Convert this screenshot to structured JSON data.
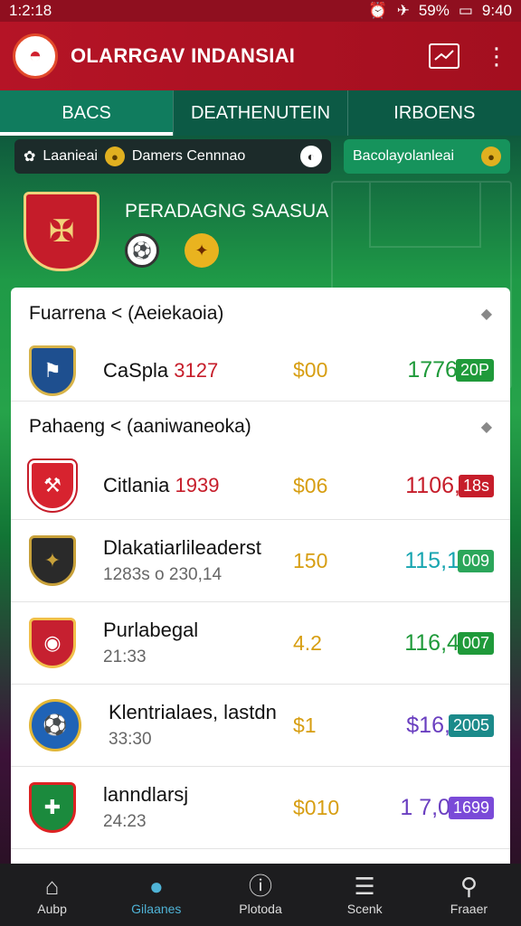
{
  "status": {
    "time": "1:2:18",
    "battery": "59%",
    "clock": "9:40"
  },
  "app": {
    "title": "OLARRGAV INDANSIAI"
  },
  "tabs": [
    {
      "label": "BACS",
      "active": true
    },
    {
      "label": "DEATHENUTEIN",
      "active": false
    },
    {
      "label": "IRBOENS",
      "active": false
    }
  ],
  "filters": {
    "left_a": "Laanieai",
    "left_b": "Damers Cennnao",
    "right": "Bacolayolanleai"
  },
  "league": {
    "name": "PERADAGNG SAASUA"
  },
  "sections": [
    {
      "header": "Fuarrena < (Aeiekaoia)",
      "rows": [
        {
          "team": "CaSpla",
          "num": "3127",
          "sub": "",
          "mid": "$00",
          "right": "1776",
          "pill": "20P",
          "color": "green"
        }
      ]
    },
    {
      "header": "Pahaeng < (aaniwaneoka)",
      "rows": [
        {
          "team": "Citlania",
          "num": "1939",
          "sub": "",
          "mid": "$06",
          "right": "1106,",
          "pill": "18s",
          "color": "red"
        },
        {
          "team": "Dlakatiarlileaderst",
          "num": "",
          "sub": "1283s o 230,14",
          "mid": "150",
          "right": "115,1",
          "pill": "009",
          "color": "teal"
        },
        {
          "team": "Purlabegal",
          "num": "",
          "sub": "21:33",
          "mid": "4.2",
          "right": "116,4",
          "pill": "007",
          "color": "green"
        },
        {
          "team": "Klentrialaes, lastdn",
          "num": "",
          "sub": "33:30",
          "mid": "$1",
          "right": "$16,",
          "pill": "2005",
          "color": "purple"
        },
        {
          "team": "lanndlarsj",
          "num": "",
          "sub": "24:23",
          "mid": "$010",
          "right": "1 7,0",
          "pill": "1699",
          "color": "purple"
        }
      ]
    }
  ],
  "nav": [
    {
      "label": "Aubp",
      "icon": "home-icon",
      "active": false
    },
    {
      "label": "Gilaanes",
      "icon": "search-icon",
      "active": true
    },
    {
      "label": "Plotoda",
      "icon": "info-icon",
      "active": false
    },
    {
      "label": "Scenk",
      "icon": "list-icon",
      "active": false
    },
    {
      "label": "Fraaer",
      "icon": "profile-icon",
      "active": false
    }
  ]
}
